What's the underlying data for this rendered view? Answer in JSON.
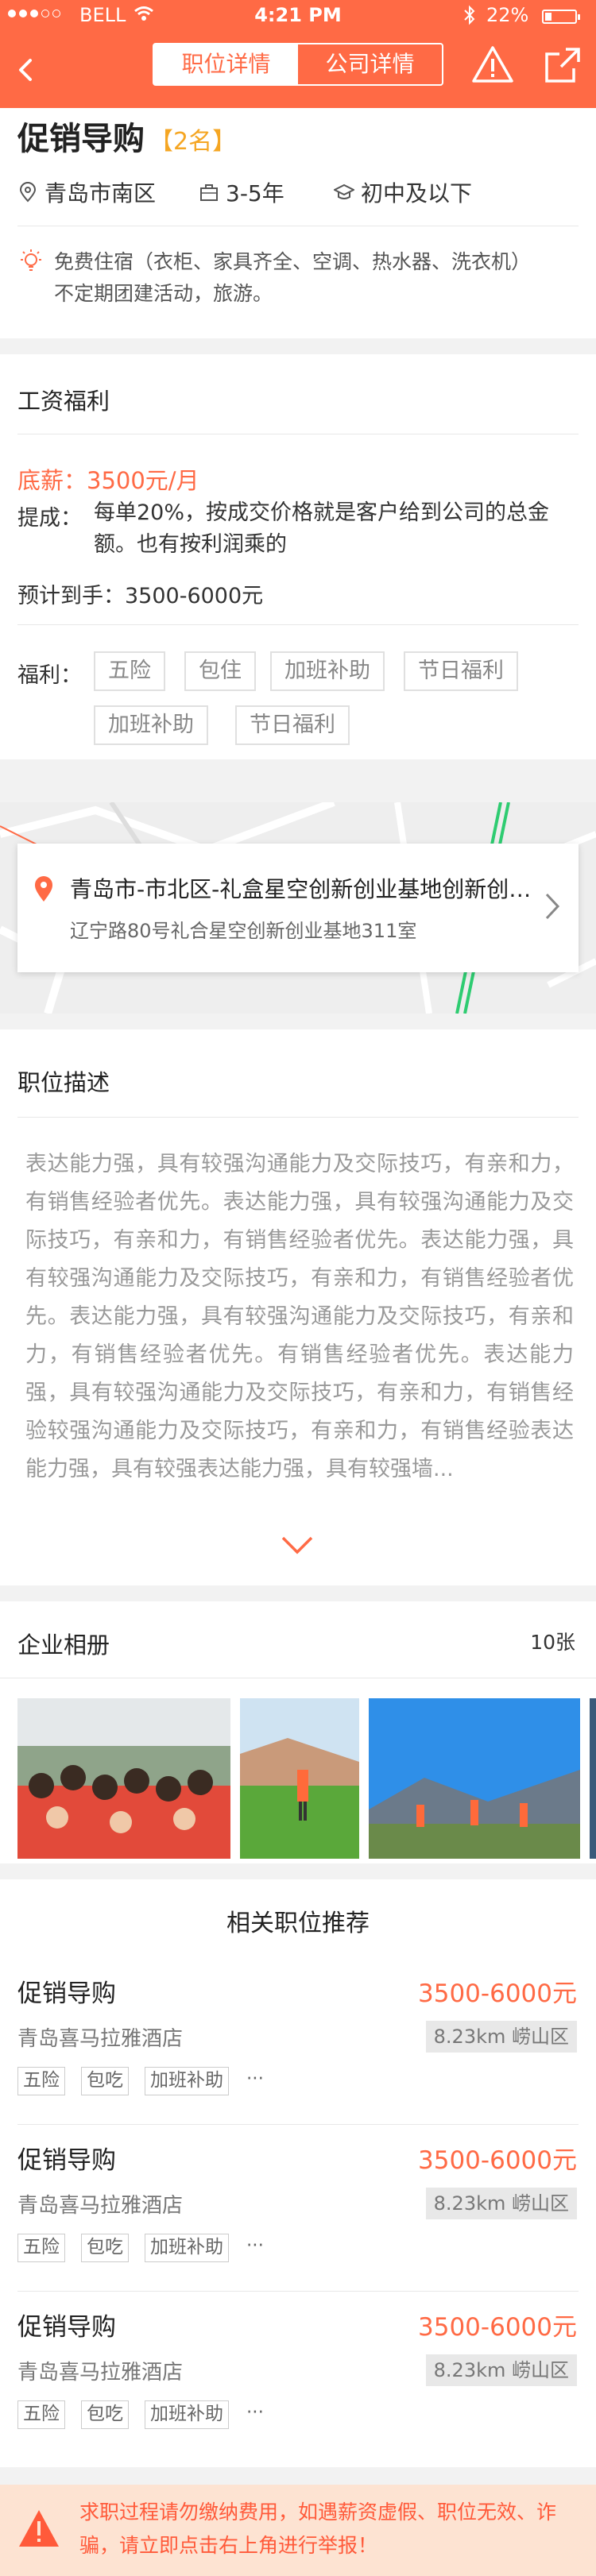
{
  "status_bar": {
    "carrier": "BELL",
    "time": "4:21 PM",
    "battery": "22%"
  },
  "nav": {
    "tab_job": "职位详情",
    "tab_company": "公司详情",
    "active_tab": "职位详情"
  },
  "job": {
    "title": "促销导购",
    "count": "【2名】",
    "location": "青岛市南区",
    "experience": "3-5年",
    "education": "初中及以下",
    "perks_line1": "免费住宿（衣柜、家具齐全、空调、热水器、洗衣机）",
    "perks_line2": "不定期团建活动，旅游。"
  },
  "salary": {
    "section_title": "工资福利",
    "base": "底薪：3500元/月",
    "commission_label": "提成：",
    "commission_text": "每单20%，按成交价格就是客户给到公司的总金额。也有按利润乘的",
    "expected": "预计到手：3500-6000元",
    "benefits_label": "福利：",
    "benefits": [
      "五险",
      "包住",
      "加班补助",
      "节日福利",
      "加班补助",
      "节日福利"
    ]
  },
  "address": {
    "main": "青岛市-市北区-礼盒星空创新创业基地创新创业基地",
    "sub": "辽宁路80号礼合星空创新创业基地311室"
  },
  "description": {
    "section_title": "职位描述",
    "text": "表达能力强，具有较强沟通能力及交际技巧，有亲和力，有销售经验者优先。表达能力强，具有较强沟通能力及交际技巧，有亲和力，有销售经验者优先。表达能力强，具有较强沟通能力及交际技巧，有亲和力，有销售经验者优先。表达能力强，具有较强沟通能力及交际技巧，有亲和力，有销售经验者优先。有销售经验者优先。表达能力强，具有较强沟通能力及交际技巧，有亲和力，有销售经验较强沟通能力及交际技巧，有亲和力，有销售经验表达能力强，具有较强表达能力强，具有较强墙..."
  },
  "album": {
    "section_title": "企业相册",
    "count": "10张"
  },
  "recommend": {
    "section_title": "相关职位推荐",
    "items": [
      {
        "name": "促销导购",
        "salary": "3500-6000元",
        "company": "青岛喜马拉雅酒店",
        "location": "8.23km  崂山区",
        "tags": [
          "五险",
          "包吃",
          "加班补助"
        ],
        "more": "···"
      },
      {
        "name": "促销导购",
        "salary": "3500-6000元",
        "company": "青岛喜马拉雅酒店",
        "location": "8.23km  崂山区",
        "tags": [
          "五险",
          "包吃",
          "加班补助"
        ],
        "more": "···"
      },
      {
        "name": "促销导购",
        "salary": "3500-6000元",
        "company": "青岛喜马拉雅酒店",
        "location": "8.23km  崂山区",
        "tags": [
          "五险",
          "包吃",
          "加班补助"
        ],
        "more": "···"
      }
    ]
  },
  "warning": {
    "text": "求职过程请勿缴纳费用，如遇薪资虚假、职位无效、诈骗，请立即点击右上角进行举报！"
  },
  "colors": {
    "brand": "#ff6a45",
    "count_badge": "#f5a623",
    "warning_bg": "#fde3d2"
  }
}
